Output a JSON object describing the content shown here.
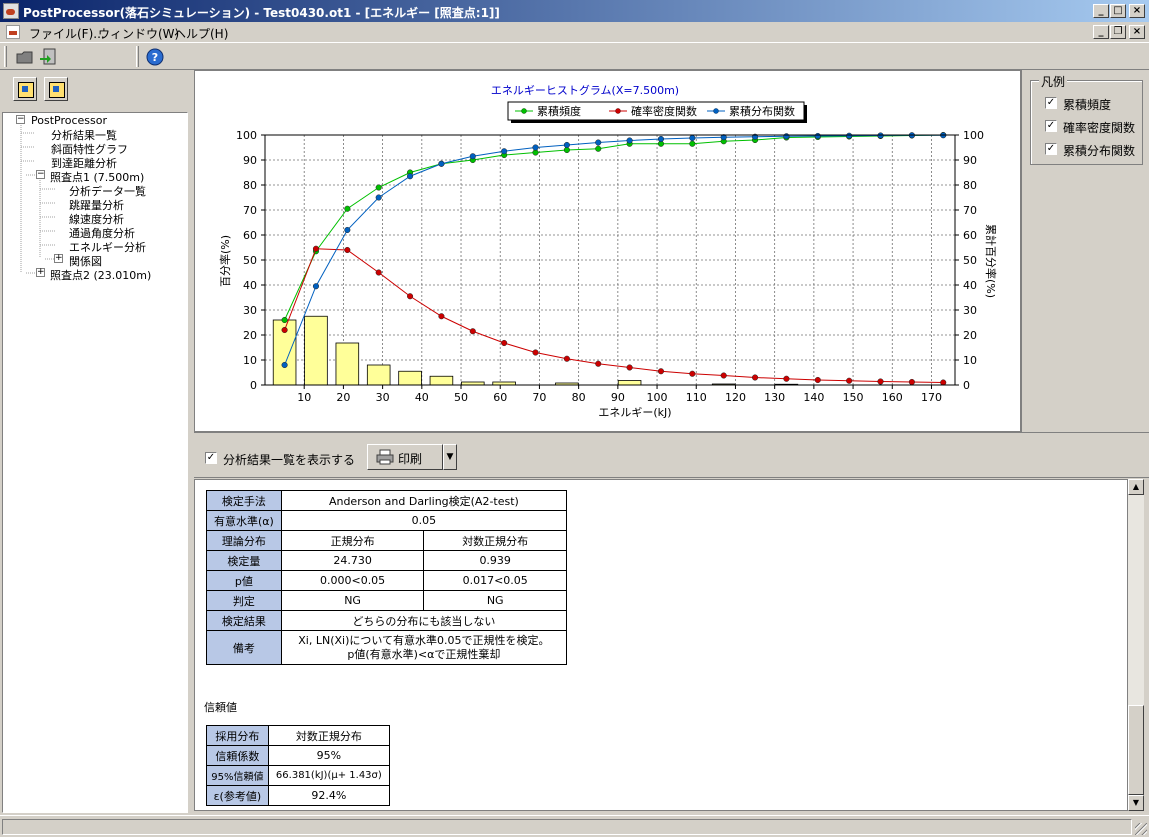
{
  "window": {
    "title": "PostProcessor(落石シミュレーション) - Test0430.ot1 - [エネルギー [照査点:1]]"
  },
  "menu": [
    {
      "label": "ファイル(F)..."
    },
    {
      "label": "ウィンドウ(W)"
    },
    {
      "label": "ヘルプ(H)"
    }
  ],
  "tree": {
    "root": "PostProcessor",
    "items": [
      {
        "label": "分析結果一覧"
      },
      {
        "label": "斜面特性グラフ"
      },
      {
        "label": "到達距離分析"
      },
      {
        "label": "照査点1 (7.500m)"
      },
      {
        "label": "分析データ一覧"
      },
      {
        "label": "跳躍量分析"
      },
      {
        "label": "線速度分析"
      },
      {
        "label": "通過角度分析"
      },
      {
        "label": "エネルギー分析"
      },
      {
        "label": "関係図"
      },
      {
        "label": "照査点2 (23.010m)"
      }
    ]
  },
  "legend_panel": {
    "title": "凡例",
    "items": [
      {
        "label": "累積頻度",
        "checked": "✓"
      },
      {
        "label": "確率密度関数",
        "checked": "✓"
      },
      {
        "label": "累積分布関数",
        "checked": "✓"
      }
    ]
  },
  "chart_data": {
    "type": "bar",
    "title": "エネルギーヒストグラム(X=7.500m)",
    "xlabel": "エネルギー(kJ)",
    "ylabel": "百分率(%)",
    "y2label": "累計百分率(%)",
    "xlim": [
      0,
      176
    ],
    "ylim": [
      0,
      100
    ],
    "y2lim": [
      0,
      100
    ],
    "xticks": [
      10,
      20,
      30,
      40,
      50,
      60,
      70,
      80,
      90,
      100,
      110,
      120,
      130,
      140,
      150,
      160,
      170
    ],
    "yticks": [
      0,
      10,
      20,
      30,
      40,
      50,
      60,
      70,
      80,
      90,
      100
    ],
    "grid": true,
    "legend_position": "top",
    "bars": {
      "color": "#ffff99",
      "x": [
        5,
        13,
        21,
        29,
        37,
        45,
        53,
        61,
        69,
        77,
        85,
        93,
        101,
        109,
        117,
        125,
        133,
        141,
        149,
        157,
        165,
        173
      ],
      "values": [
        26,
        27.5,
        16.8,
        8,
        5.5,
        3.5,
        1.2,
        1.2,
        0,
        0.8,
        0,
        1.8,
        0,
        0,
        0.4,
        0,
        0.3,
        0,
        0,
        0,
        0,
        0
      ]
    },
    "series": [
      {
        "name": "累積頻度",
        "color": "#00c000",
        "x": [
          5,
          13,
          21,
          29,
          37,
          45,
          53,
          61,
          69,
          77,
          85,
          93,
          101,
          109,
          117,
          125,
          133,
          141,
          149,
          157,
          165,
          173
        ],
        "values": [
          26,
          53.5,
          70.5,
          79,
          85,
          88.5,
          90,
          92,
          93,
          94,
          94.5,
          96.5,
          96.5,
          96.5,
          97.5,
          98,
          99,
          99.2,
          99.4,
          99.6,
          99.8,
          100
        ]
      },
      {
        "name": "確率密度関数",
        "color": "#cc0000",
        "x": [
          5,
          13,
          21,
          29,
          37,
          45,
          53,
          61,
          69,
          77,
          85,
          93,
          101,
          109,
          117,
          125,
          133,
          141,
          149,
          157,
          165,
          173
        ],
        "values": [
          22,
          54.5,
          54,
          45,
          35.5,
          27.5,
          21.5,
          16.8,
          13,
          10.5,
          8.5,
          7,
          5.5,
          4.5,
          3.8,
          3,
          2.5,
          2,
          1.7,
          1.4,
          1.2,
          1
        ]
      },
      {
        "name": "累積分布関数",
        "color": "#0060c0",
        "x": [
          5,
          13,
          21,
          29,
          37,
          45,
          53,
          61,
          69,
          77,
          85,
          93,
          101,
          109,
          117,
          125,
          133,
          141,
          149,
          157,
          165,
          173
        ],
        "values": [
          8,
          39.5,
          62,
          75,
          83.5,
          88.5,
          91.5,
          93.5,
          95,
          96,
          97,
          97.8,
          98.4,
          98.8,
          99.1,
          99.3,
          99.5,
          99.6,
          99.7,
          99.8,
          99.9,
          99.9
        ]
      }
    ]
  },
  "controls": {
    "show_list_label": "分析結果一覧を表示する",
    "show_list_checked": "✓",
    "print_label": "印刷",
    "dropdown_arrow": "▼"
  },
  "test_table": {
    "method_label": "検定手法",
    "method_value": "Anderson and Darling検定(A2-test)",
    "alpha_label": "有意水準(α)",
    "alpha_value": "0.05",
    "dist_label": "理論分布",
    "dist_normal": "正規分布",
    "dist_lognormal": "対数正規分布",
    "stat_label": "検定量",
    "stat_normal": "24.730",
    "stat_lognormal": "0.939",
    "p_label": "p値",
    "p_normal": "0.000<0.05",
    "p_lognormal": "0.017<0.05",
    "judge_label": "判定",
    "judge_normal": "NG",
    "judge_lognormal": "NG",
    "result_label": "検定結果",
    "result_value": "どちらの分布にも該当しない",
    "note_label": "備考",
    "note_line1": "Xi, LN(Xi)について有意水準0.05で正規性を検定。",
    "note_line2": "p値(有意水準)<αで正規性棄却"
  },
  "reliability": {
    "heading": "信頼値",
    "dist_label": "採用分布",
    "dist_value": "対数正規分布",
    "coef_label": "信頼係数",
    "coef_value": "95%",
    "value_label": "95%信頼値",
    "value_value": "66.381(kJ)(μ+ 1.43σ)",
    "eps_label": "ε(参考値)",
    "eps_value": "92.4%"
  }
}
